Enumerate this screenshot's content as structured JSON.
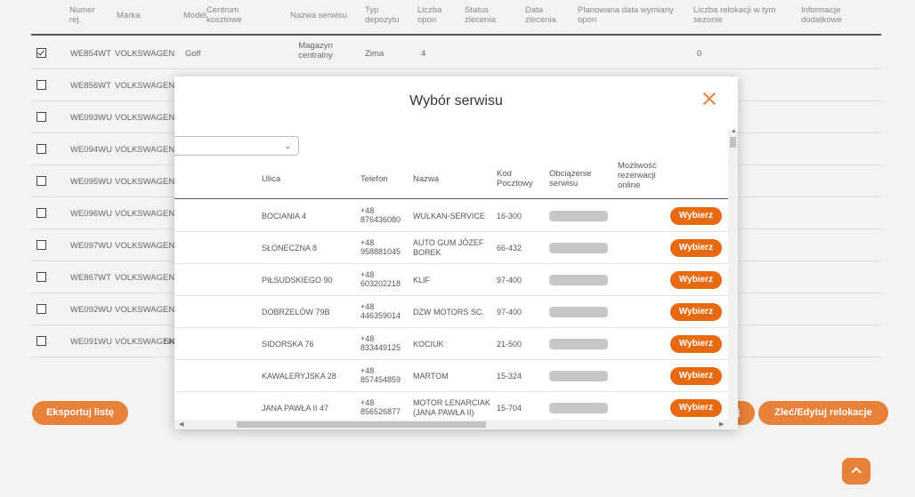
{
  "main_table": {
    "headers": [
      "Numer rej.",
      "Marka",
      "Model",
      "Centrum kosztowe",
      "Nazwa serwisu",
      "Typ depozytu",
      "Liczba opon",
      "Status zlecenia",
      "Data zlecenia",
      "Planowana data wymiany opon",
      "Liczba relokacji w tym sezonie",
      "Informacje dodatkowe"
    ],
    "rows": [
      {
        "reg": "WE854WT",
        "make": "VOLKSWAGEN",
        "model": "Golf",
        "service": "Magazyn centralny",
        "deposit": "Zima",
        "tires": "4",
        "relocations": "0",
        "checked": true
      },
      {
        "reg": "WE856WT",
        "make": "VOLKSWAGEN",
        "checked": false
      },
      {
        "reg": "WE093WU",
        "make": "VOLKSWAGEN",
        "checked": false
      },
      {
        "reg": "WE094WU",
        "make": "VOLKSWAGEN",
        "checked": false
      },
      {
        "reg": "WE095WU",
        "make": "VOLKSWAGEN",
        "checked": false
      },
      {
        "reg": "WE096WU",
        "make": "VOLKSWAGEN",
        "checked": false
      },
      {
        "reg": "WE097WU",
        "make": "VOLKSWAGEN",
        "checked": false
      },
      {
        "reg": "WE867WT",
        "make": "VOLKSWAGEN",
        "checked": false
      },
      {
        "reg": "WE092WU",
        "make": "VOLKSWAGEN",
        "checked": false
      },
      {
        "reg": "WE091WU",
        "make": "VOLKSWAGEN",
        "extra": "SKA",
        "checked": false
      }
    ]
  },
  "buttons": {
    "export": "Eksportuj listę",
    "relocate": "Zleć/Edytuj relokacje",
    "partial_right": "j"
  },
  "modal": {
    "title": "Wybór serwisu",
    "select_value": "",
    "headers": {
      "street": "Ulica",
      "phone": "Telefon",
      "name": "Nazwa",
      "postal": "Kod Pocztowy",
      "load": "Obciążenie serwisu",
      "online": "Możliwość rezerwacji online"
    },
    "pick_label": "Wybierz",
    "rows": [
      {
        "street": "BOCIANIA 4",
        "phone1": "+48",
        "phone2": "876436080",
        "name1": "WULKAN-SERVICE",
        "name2": "",
        "postal": "16-300"
      },
      {
        "street": "SŁONECZNA 8",
        "phone1": "+48",
        "phone2": "958881045",
        "name1": "AUTO GUM JÓZEF",
        "name2": "BOREK",
        "postal": "66-432"
      },
      {
        "street": "PIŁSUDSKIEGO 90",
        "phone1": "+48",
        "phone2": "603202218",
        "name1": "KLIF",
        "name2": "",
        "postal": "97-400"
      },
      {
        "street": "DOBRZELÓW 79B",
        "phone1": "+48",
        "phone2": "446359014",
        "name1": "DZW MOTORS SC.",
        "name2": "",
        "postal": "97-400"
      },
      {
        "street": "SIDORSKA 76",
        "phone1": "+48",
        "phone2": "833449125",
        "name1": "KOCIUK",
        "name2": "",
        "postal": "21-500"
      },
      {
        "street": "KAWALERYJSKA 28",
        "phone1": "+48",
        "phone2": "857454859",
        "name1": "MARTOM",
        "name2": "",
        "postal": "15-324"
      },
      {
        "street": "JANA PAWŁA II 47",
        "phone1": "+48",
        "phone2": "856526877",
        "name1": "MOTOR LENARCIAK",
        "name2": "(JANA PAWŁA II)",
        "postal": "15-704"
      }
    ]
  },
  "colors": {
    "accent": "#e8823a",
    "pick_button": "#e86a10",
    "load_bar": "#c7c7c7"
  },
  "icons": {
    "close": "close-icon",
    "select_chevron": "chevron-down-icon",
    "scroll_top": "chevron-up-icon"
  }
}
